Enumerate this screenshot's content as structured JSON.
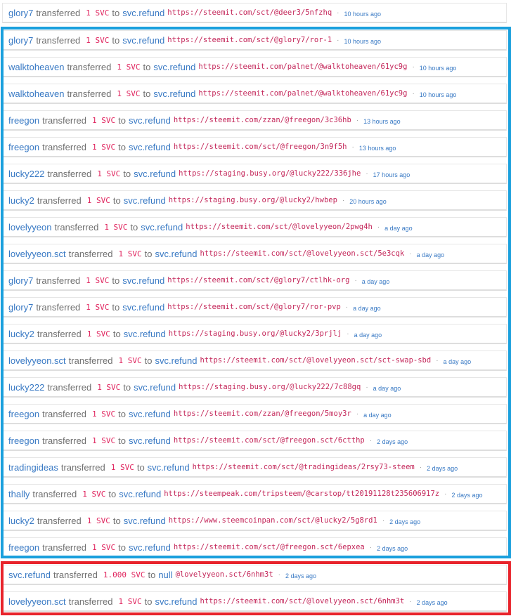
{
  "feed": {
    "items": [
      {
        "sender": "glory7",
        "verb": "transferred",
        "amount": "1 SVC",
        "to": "to",
        "recipient": "svc.refund",
        "memo": "https://steemit.com/sct/@deer3/5nfzhq",
        "dot": "·",
        "time": "10 hours ago"
      },
      {
        "sender": "glory7",
        "verb": "transferred",
        "amount": "1 SVC",
        "to": "to",
        "recipient": "svc.refund",
        "memo": "https://steemit.com/sct/@glory7/ror-1",
        "dot": "·",
        "time": "10 hours ago"
      },
      {
        "sender": "walktoheaven",
        "verb": "transferred",
        "amount": "1 SVC",
        "to": "to",
        "recipient": "svc.refund",
        "memo": "https://steemit.com/palnet/@walktoheaven/61yc9g",
        "dot": "·",
        "time": "10 hours ago"
      },
      {
        "sender": "walktoheaven",
        "verb": "transferred",
        "amount": "1 SVC",
        "to": "to",
        "recipient": "svc.refund",
        "memo": "https://steemit.com/palnet/@walktoheaven/61yc9g",
        "dot": "·",
        "time": "10 hours ago"
      },
      {
        "sender": "freegon",
        "verb": "transferred",
        "amount": "1 SVC",
        "to": "to",
        "recipient": "svc.refund",
        "memo": "https://steemit.com/zzan/@freegon/3c36hb",
        "dot": "·",
        "time": "13 hours ago"
      },
      {
        "sender": "freegon",
        "verb": "transferred",
        "amount": "1 SVC",
        "to": "to",
        "recipient": "svc.refund",
        "memo": "https://steemit.com/sct/@freegon/3n9f5h",
        "dot": "·",
        "time": "13 hours ago"
      },
      {
        "sender": "lucky222",
        "verb": "transferred",
        "amount": "1 SVC",
        "to": "to",
        "recipient": "svc.refund",
        "memo": "https://staging.busy.org/@lucky222/336jhe",
        "dot": "·",
        "time": "17 hours ago"
      },
      {
        "sender": "lucky2",
        "verb": "transferred",
        "amount": "1 SVC",
        "to": "to",
        "recipient": "svc.refund",
        "memo": "https://staging.busy.org/@lucky2/hwbep",
        "dot": "·",
        "time": "20 hours ago"
      },
      {
        "sender": "lovelyyeon",
        "verb": "transferred",
        "amount": "1 SVC",
        "to": "to",
        "recipient": "svc.refund",
        "memo": "https://steemit.com/sct/@lovelyyeon/2pwg4h",
        "dot": "·",
        "time": "a day ago"
      },
      {
        "sender": "lovelyyeon.sct",
        "verb": "transferred",
        "amount": "1 SVC",
        "to": "to",
        "recipient": "svc.refund",
        "memo": "https://steemit.com/sct/@lovelyyeon.sct/5e3cqk",
        "dot": "·",
        "time": "a day ago"
      },
      {
        "sender": "glory7",
        "verb": "transferred",
        "amount": "1 SVC",
        "to": "to",
        "recipient": "svc.refund",
        "memo": "https://steemit.com/sct/@glory7/ctlhk-org",
        "dot": "·",
        "time": "a day ago"
      },
      {
        "sender": "glory7",
        "verb": "transferred",
        "amount": "1 SVC",
        "to": "to",
        "recipient": "svc.refund",
        "memo": "https://steemit.com/sct/@glory7/ror-pvp",
        "dot": "·",
        "time": "a day ago"
      },
      {
        "sender": "lucky2",
        "verb": "transferred",
        "amount": "1 SVC",
        "to": "to",
        "recipient": "svc.refund",
        "memo": "https://staging.busy.org/@lucky2/3prjlj",
        "dot": "·",
        "time": "a day ago"
      },
      {
        "sender": "lovelyyeon.sct",
        "verb": "transferred",
        "amount": "1 SVC",
        "to": "to",
        "recipient": "svc.refund",
        "memo": "https://steemit.com/sct/@lovelyyeon.sct/sct-swap-sbd",
        "dot": "·",
        "time": "a day ago"
      },
      {
        "sender": "lucky222",
        "verb": "transferred",
        "amount": "1 SVC",
        "to": "to",
        "recipient": "svc.refund",
        "memo": "https://staging.busy.org/@lucky222/7c88gq",
        "dot": "·",
        "time": "a day ago"
      },
      {
        "sender": "freegon",
        "verb": "transferred",
        "amount": "1 SVC",
        "to": "to",
        "recipient": "svc.refund",
        "memo": "https://steemit.com/zzan/@freegon/5moy3r",
        "dot": "·",
        "time": "a day ago"
      },
      {
        "sender": "freegon",
        "verb": "transferred",
        "amount": "1 SVC",
        "to": "to",
        "recipient": "svc.refund",
        "memo": "https://steemit.com/sct/@freegon.sct/6ctthp",
        "dot": "·",
        "time": "2 days ago"
      },
      {
        "sender": "tradingideas",
        "verb": "transferred",
        "amount": "1 SVC",
        "to": "to",
        "recipient": "svc.refund",
        "memo": "https://steemit.com/sct/@tradingideas/2rsy73-steem",
        "dot": "·",
        "time": "2 days ago"
      },
      {
        "sender": "thally",
        "verb": "transferred",
        "amount": "1 SVC",
        "to": "to",
        "recipient": "svc.refund",
        "memo": "https://steempeak.com/tripsteem/@carstop/tt20191128t235606917z",
        "dot": "·",
        "time": "2 days ago"
      },
      {
        "sender": "lucky2",
        "verb": "transferred",
        "amount": "1 SVC",
        "to": "to",
        "recipient": "svc.refund",
        "memo": "https://www.steemcoinpan.com/sct/@lucky2/5g8rd1",
        "dot": "·",
        "time": "2 days ago"
      },
      {
        "sender": "freegon",
        "verb": "transferred",
        "amount": "1 SVC",
        "to": "to",
        "recipient": "svc.refund",
        "memo": "https://steemit.com/sct/@freegon.sct/6epxea",
        "dot": "·",
        "time": "2 days ago"
      },
      {
        "sender": "svc.refund",
        "verb": "transferred",
        "amount": "1.000 SVC",
        "to": "to",
        "recipient": "null",
        "memo": "@lovelyyeon.sct/6nhm3t",
        "dot": "·",
        "time": "2 days ago"
      },
      {
        "sender": "lovelyyeon.sct",
        "verb": "transferred",
        "amount": "1 SVC",
        "to": "to",
        "recipient": "svc.refund",
        "memo": "https://steemit.com/sct/@lovelyyeon.sct/6nhm3t",
        "dot": "·",
        "time": "2 days ago"
      }
    ]
  },
  "highlights": {
    "blue_color": "#1aa0dd",
    "red_color": "#e8232b"
  }
}
